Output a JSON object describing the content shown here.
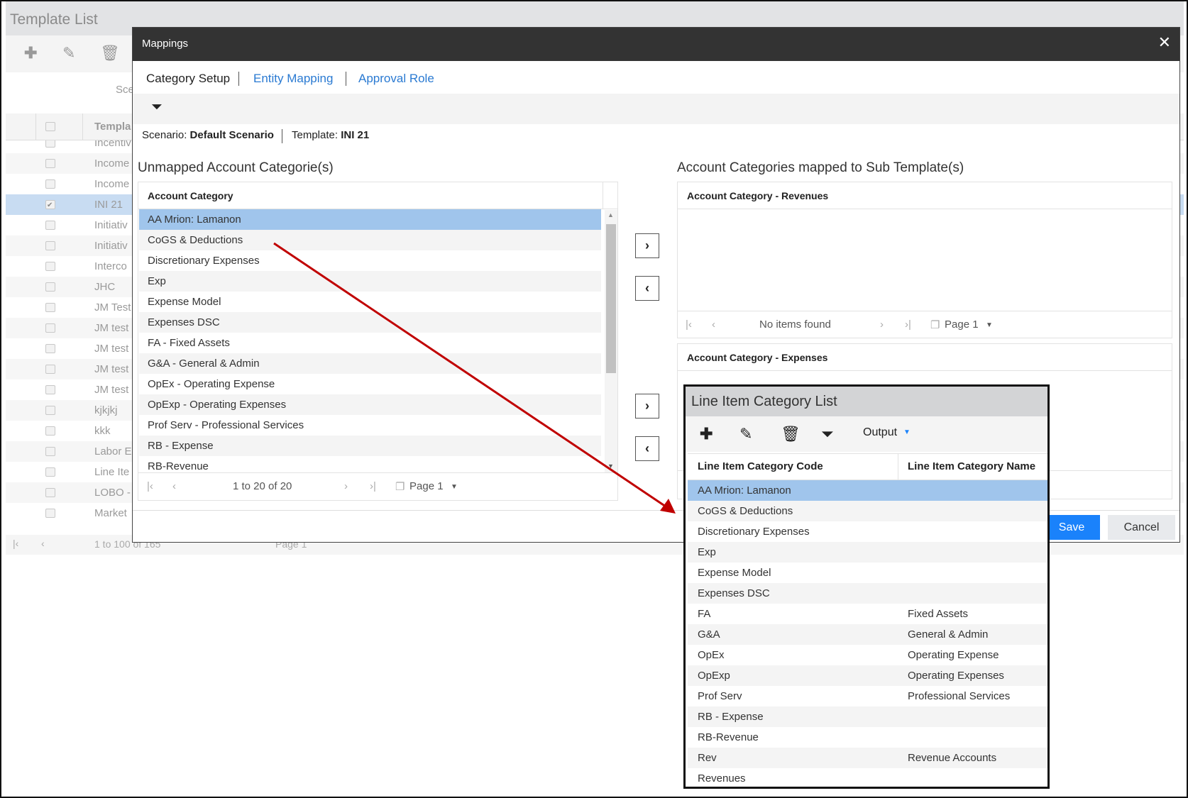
{
  "background": {
    "title": "Template List",
    "scenario_fragment": "Sce",
    "column_header": "Templa",
    "rows": [
      {
        "label": "Incentiv",
        "checked": false
      },
      {
        "label": "Income",
        "checked": false
      },
      {
        "label": "Income",
        "checked": false
      },
      {
        "label": "INI 21",
        "checked": true
      },
      {
        "label": "Initiativ",
        "checked": false
      },
      {
        "label": "Initiativ",
        "checked": false
      },
      {
        "label": "Interco",
        "checked": false
      },
      {
        "label": "JHC",
        "checked": false
      },
      {
        "label": "JM Test",
        "checked": false
      },
      {
        "label": "JM test",
        "checked": false
      },
      {
        "label": "JM test",
        "checked": false
      },
      {
        "label": "JM test",
        "checked": false
      },
      {
        "label": "JM test",
        "checked": false
      },
      {
        "label": "kjkjkj",
        "checked": false
      },
      {
        "label": "kkk",
        "checked": false
      },
      {
        "label": "Labor E",
        "checked": false
      },
      {
        "label": "Line Ite",
        "checked": false
      },
      {
        "label": "LOBO -",
        "checked": false
      },
      {
        "label": "Market",
        "checked": false
      }
    ],
    "pager": {
      "range": "1 to 100 of 165",
      "page": "Page 1"
    }
  },
  "modal": {
    "title": "Mappings",
    "close": "✕",
    "tabs": [
      {
        "label": "Category Setup",
        "active": true
      },
      {
        "label": "Entity Mapping",
        "active": false
      },
      {
        "label": "Approval Role",
        "active": false
      }
    ],
    "scenario_label": "Scenario:",
    "scenario_value": "Default Scenario",
    "template_label": "Template:",
    "template_value": "INI 21",
    "unmapped": {
      "title": "Unmapped Account Categorie(s)",
      "column": "Account Category",
      "rows": [
        "AA Mrion: Lamanon",
        "CoGS & Deductions",
        "Discretionary Expenses",
        "Exp",
        "Expense Model",
        "Expenses DSC",
        "FA - Fixed Assets",
        "G&A - General & Admin",
        "OpEx - Operating Expense",
        "OpExp - Operating Expenses",
        "Prof Serv - Professional Services",
        "RB - Expense",
        "RB-Revenue"
      ],
      "selected_index": 0,
      "pager": {
        "range": "1 to 20 of 20",
        "page": "Page 1"
      }
    },
    "move_buttons": {
      "right": "›",
      "left": "‹"
    },
    "mapped": {
      "title": "Account Categories mapped to Sub Template(s)",
      "revenues": {
        "column": "Account Category - Revenues",
        "pager": {
          "range": "No items found",
          "page": "Page 1"
        }
      },
      "expenses": {
        "column": "Account Category - Expenses"
      }
    },
    "save": "Save",
    "cancel": "Cancel",
    "accent": "#1a82fb"
  },
  "callout": {
    "title": "Line Item Category List",
    "output": "Output",
    "columns": [
      "Line Item Category Code",
      "Line Item Category Name"
    ],
    "rows": [
      {
        "code": "AA Mrion: Lamanon",
        "name": ""
      },
      {
        "code": "CoGS & Deductions",
        "name": ""
      },
      {
        "code": "Discretionary Expenses",
        "name": ""
      },
      {
        "code": "Exp",
        "name": ""
      },
      {
        "code": "Expense Model",
        "name": ""
      },
      {
        "code": "Expenses DSC",
        "name": ""
      },
      {
        "code": "FA",
        "name": "Fixed Assets"
      },
      {
        "code": "G&A",
        "name": "General & Admin"
      },
      {
        "code": "OpEx",
        "name": "Operating Expense"
      },
      {
        "code": "OpExp",
        "name": "Operating Expenses"
      },
      {
        "code": "Prof Serv",
        "name": "Professional Services"
      },
      {
        "code": "RB - Expense",
        "name": ""
      },
      {
        "code": "RB-Revenue",
        "name": ""
      },
      {
        "code": "Rev",
        "name": "Revenue Accounts"
      },
      {
        "code": "Revenues",
        "name": ""
      }
    ],
    "selected_index": 0,
    "arrow_color": "#c00000"
  }
}
